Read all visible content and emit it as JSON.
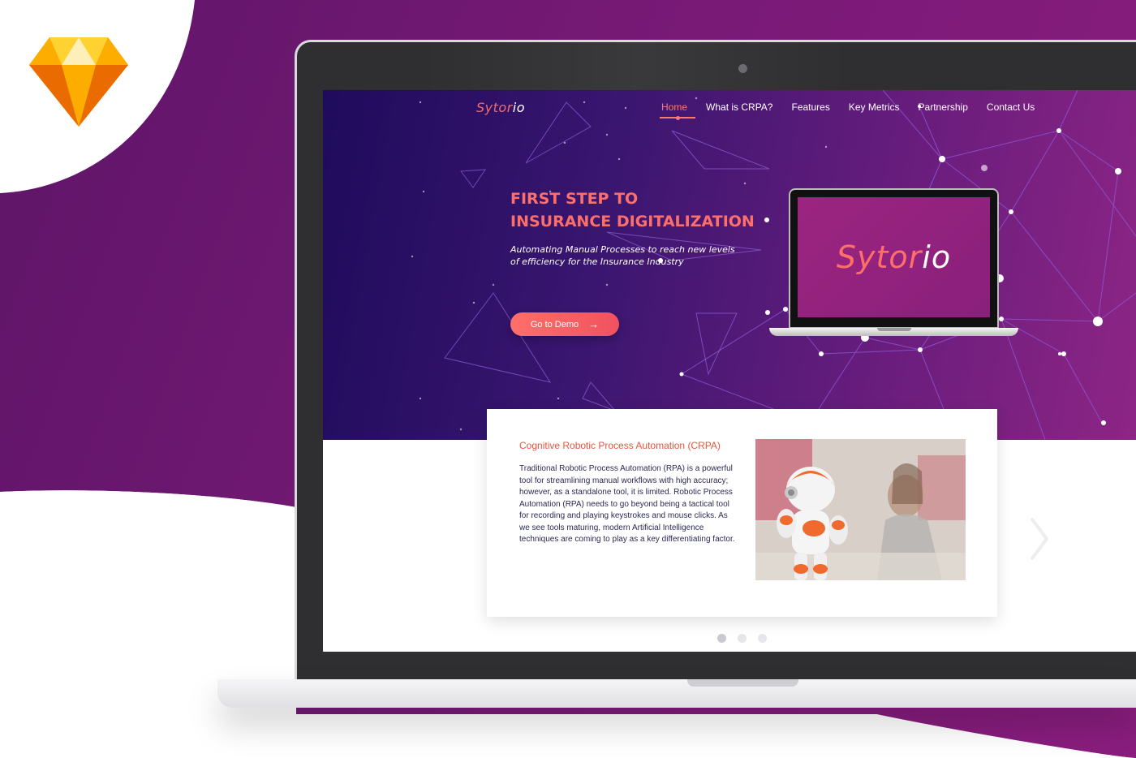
{
  "brand": {
    "name_main": "Sytor",
    "name_accent": "io"
  },
  "nav": {
    "items": [
      "Home",
      "What is CRPA?",
      "Features",
      "Key Metrics",
      "Partnership",
      "Contact Us"
    ],
    "active_index": 0
  },
  "hero": {
    "title_line1": "FIRST STEP TO",
    "title_line2": "INSURANCE DIGITALIZATION",
    "subtitle": "Automating Manual Processes to reach new levels of efficiency for the Insurance Industry",
    "cta_label": "Go to Demo",
    "cta_icon": "arrow-right-icon"
  },
  "mini_laptop": {
    "brand_main": "Sytor",
    "brand_accent": "io"
  },
  "card": {
    "title": "Cognitive Robotic Process Automation (CRPA)",
    "body": "Traditional Robotic Process Automation (RPA) is a powerful tool for streamlining manual workflows with high accuracy; however, as a standalone tool, it is limited. Robotic Process Automation (RPA) needs to go beyond being a tactical tool for recording and playing keystrokes and mouse clicks. As we see tools maturing, modern Artificial Intelligence techniques are coming to play as a key differentiating factor.",
    "photo": "robot-photo"
  },
  "carousel": {
    "slide_count": 3,
    "active_slide": 1,
    "next_icon": "chevron-right-icon"
  },
  "colors": {
    "accent": "#ff6f6a",
    "backdrop_purple": "#7b1a78",
    "hero_dark": "#1f0b5c",
    "body_text": "#2a2a52"
  }
}
